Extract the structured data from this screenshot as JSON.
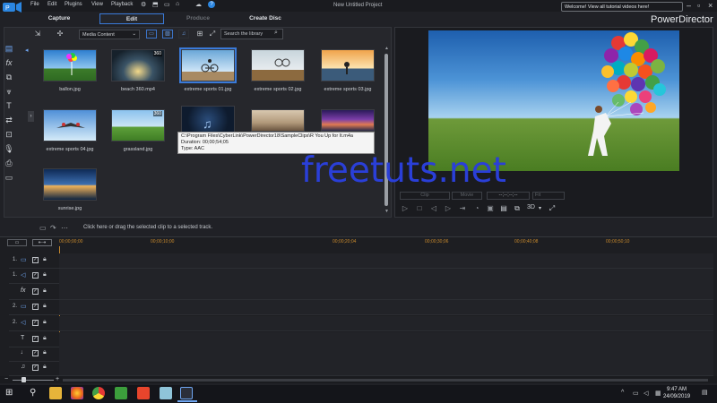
{
  "app": {
    "brand": "PowerDirector",
    "project_title": "New Untitled Project",
    "welcome_message": "Welcome! View all tutorial videos here!"
  },
  "menu": [
    "File",
    "Edit",
    "Plugins",
    "View",
    "Playback"
  ],
  "mode_tabs": [
    "Capture",
    "Edit",
    "Produce",
    "Create Disc"
  ],
  "library": {
    "filter": "Media Content",
    "search_placeholder": "Search the library",
    "items": [
      {
        "label": "ballon.jpg"
      },
      {
        "label": "beach 360.mp4",
        "badge": "360"
      },
      {
        "label": "extreme sports 01.jpg"
      },
      {
        "label": "extreme sports 02.jpg"
      },
      {
        "label": "extreme sports 03.jpg"
      },
      {
        "label": "extreme sports 04.jpg"
      },
      {
        "label": "grassland.jpg",
        "badge": "360"
      },
      {
        "label": ""
      },
      {
        "label": ""
      },
      {
        "label": ""
      },
      {
        "label": "sunrise.jpg"
      }
    ],
    "tooltip": {
      "path": "C:\\Program Files\\CyberLink\\PowerDirector18\\SampleClips\\R You Up for It.m4a",
      "duration": "Duration: 00;00;54;05",
      "type": "Type: AAC"
    }
  },
  "preview": {
    "clip_label": "Clip",
    "movie_label": "Movie",
    "timecode": "--;--;--;--",
    "fit_label": "Fit",
    "mode_3d": "3D"
  },
  "hint": "Click here or drag the selected clip to a selected track.",
  "watermark": "freetuts.net",
  "timeline": {
    "ruler": [
      "00;00;00;00",
      "00;00;10;00",
      "00;00;20;04",
      "00;00;30;06",
      "00;00;40;08",
      "00;00;50;10"
    ],
    "tracks": [
      {
        "num": "1.",
        "kind": "video"
      },
      {
        "num": "1.",
        "kind": "audio"
      },
      {
        "num": "",
        "kind": "fx"
      },
      {
        "num": "2.",
        "kind": "video"
      },
      {
        "num": "2.",
        "kind": "audio"
      },
      {
        "num": "",
        "kind": "title"
      },
      {
        "num": "",
        "kind": "voice"
      },
      {
        "num": "",
        "kind": "music"
      }
    ]
  },
  "taskbar": {
    "time": "9:47 AM",
    "date": "24/09/2019"
  }
}
